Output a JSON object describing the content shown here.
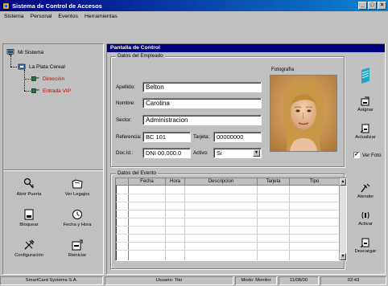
{
  "window": {
    "title": "Sistema de Control de Accesos"
  },
  "menu": [
    "Sistema",
    "Personal",
    "Eventos",
    "Herramientas"
  ],
  "tree": {
    "root": "Mi Sistema",
    "site": "La Plata Cereal",
    "doors": [
      "Dirección",
      "Entrada VIP"
    ]
  },
  "actions": {
    "abrir_puerta": "Abrir Puerta",
    "ver_legajos": "Ver Legajos",
    "bloquear": "Bloquear",
    "fecha_hora": "Fecha y Hora",
    "configuracion": "Configuración",
    "reiniciar": "Reiniciar"
  },
  "main": {
    "title": "Pantalla de Control",
    "employee_group": "Datos del Empleado",
    "photo_label": "Fotografía",
    "labels": {
      "apellido": "Apellido:",
      "nombre": "Nombre:",
      "sector": "Sector:",
      "referencia": "Referencia:",
      "tarjeta": "Tarjeta:",
      "docid": "Doc.Id.:",
      "activo": "Activo:"
    },
    "values": {
      "apellido": "Belton",
      "nombre": "Carolina",
      "sector": "Administracion",
      "referencia": "BC 101",
      "tarjeta": "00000000",
      "docid": "DNI 00.000.0",
      "activo": "Si"
    },
    "side_buttons": {
      "asignar": "Asignar",
      "actualizar": "Actualizar",
      "ver_foto": "Ver Foto"
    },
    "ver_foto_checked": true,
    "event_group": "Datos del Evento",
    "event_columns": [
      "Fecha",
      "Hora",
      "Descripcion",
      "Tarjeta",
      "Tipo"
    ],
    "event_buttons": {
      "atender": "Atender",
      "activar": "Activar",
      "descargar": "Descargar"
    }
  },
  "status": {
    "company": "SmartCard Systems S.A.",
    "usuario": "Usuario: Tito",
    "modo": "Modo: Monitor",
    "fecha": "11/08/00",
    "hora": "02:43"
  },
  "colors": {
    "title_bar": "#000080",
    "tree_red": "#c00000",
    "face": "#c0c0c0"
  }
}
